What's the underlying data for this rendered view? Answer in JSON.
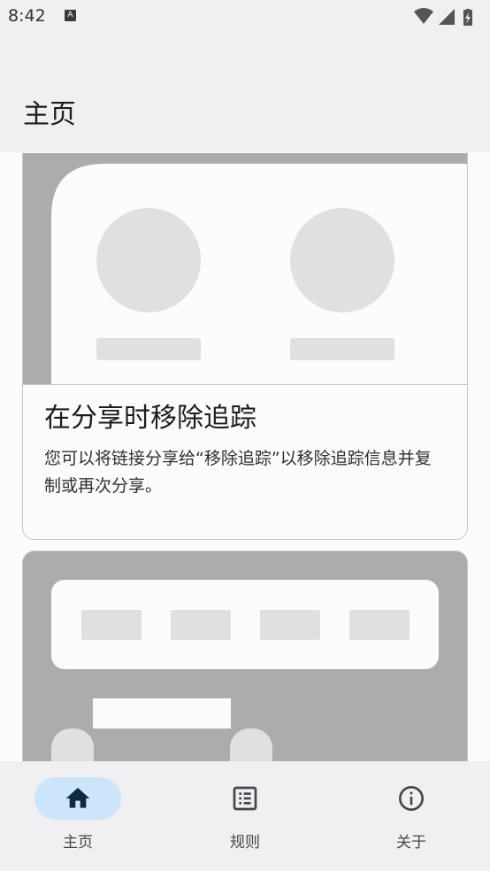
{
  "status_bar": {
    "time": "8:42",
    "notification_icon": "a-icon",
    "icons": [
      "wifi-icon",
      "signal-icon",
      "battery-icon"
    ]
  },
  "app_bar": {
    "title": "主页"
  },
  "cards": [
    {
      "illustration": "two-avatars-placeholder",
      "title": "在分享时移除追踪",
      "body": "您可以将链接分享给“移除追踪”以移除追踪信息并复制或再次分享。"
    },
    {
      "illustration": "toolbar-placeholder"
    }
  ],
  "bottom_nav": {
    "items": [
      {
        "label": "主页",
        "icon": "home-icon",
        "selected": true
      },
      {
        "label": "规则",
        "icon": "list-icon",
        "selected": false
      },
      {
        "label": "关于",
        "icon": "info-icon",
        "selected": false
      }
    ]
  },
  "colors": {
    "surface": "#f0eff1",
    "background": "#fdfcfb",
    "indicator": "#cde5fb",
    "icon_selected": "#0d2a3e",
    "placeholder_dark": "#adacab",
    "placeholder_light": "#dfe1df"
  }
}
